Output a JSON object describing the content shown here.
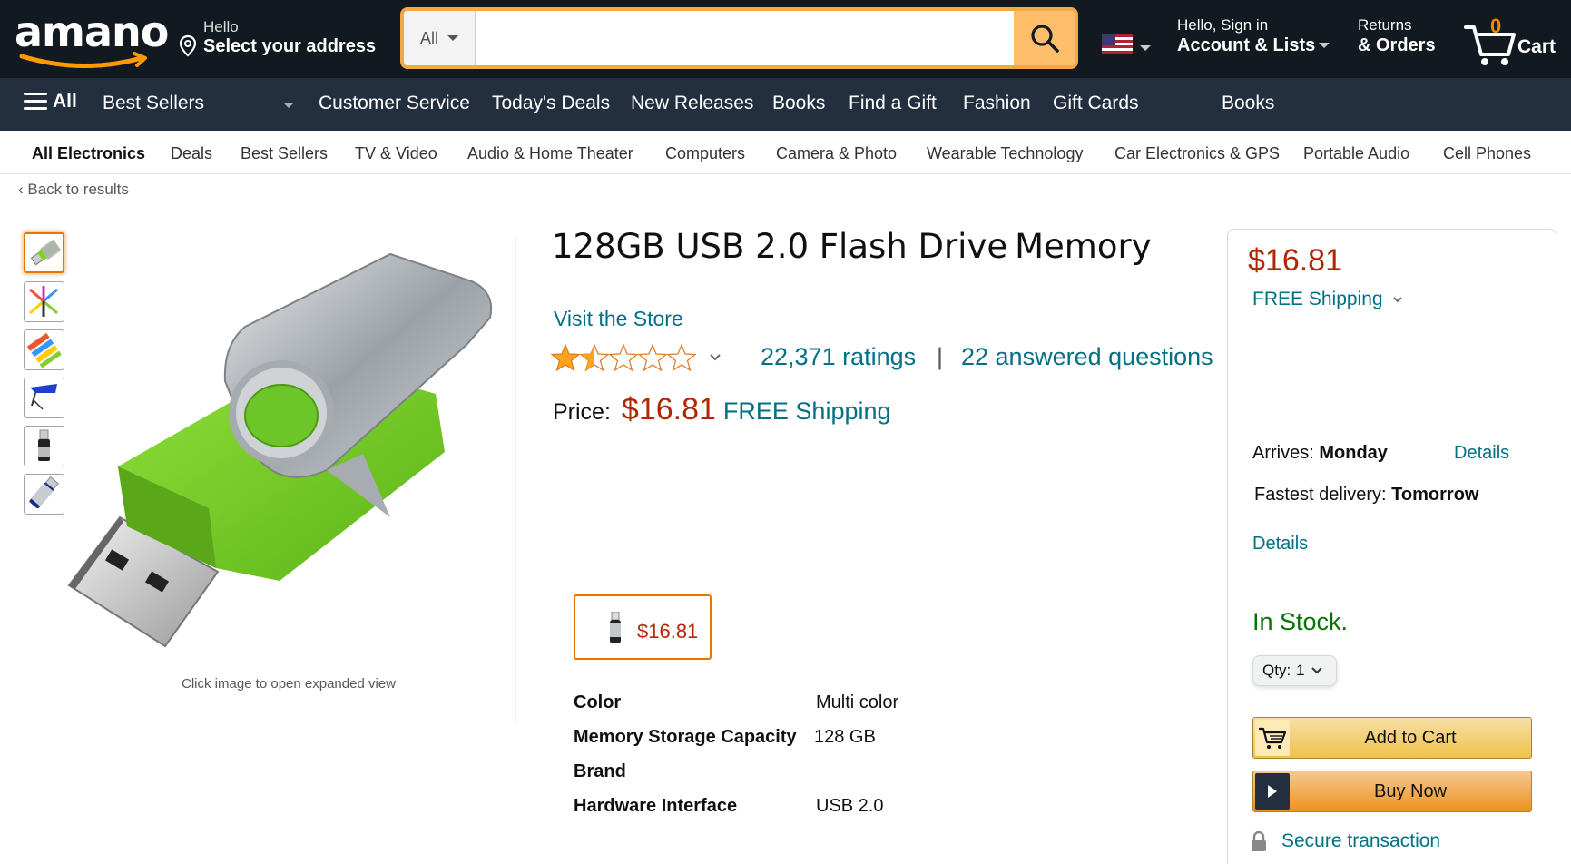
{
  "header": {
    "logo_text": "amano",
    "address_hello": "Hello",
    "address_prompt": "Select your address",
    "search_category": "All",
    "search_value": "",
    "search_placeholder": "",
    "account_hello": "Hello, Sign in",
    "account_lists": "Account & Lists",
    "returns_label": "Returns",
    "orders_label": "& Orders",
    "cart_count": "0",
    "cart_label": "Cart"
  },
  "nav": {
    "all_label": "All",
    "items": [
      "Best Sellers",
      "Customer Service",
      "Today's Deals",
      "New Releases",
      "Books",
      "Find a Gift",
      "Fashion",
      "Gift Cards",
      "Books"
    ]
  },
  "subnav": {
    "items": [
      "All Electronics",
      "Deals",
      "Best Sellers",
      "TV & Video",
      "Audio & Home Theater",
      "Computers",
      "Camera & Photo",
      "Wearable Technology",
      "Car Electronics & GPS",
      "Portable Audio",
      "Cell Phones"
    ]
  },
  "back_to_results": "Back to results",
  "gallery": {
    "caption": "Click image to open expanded view",
    "thumbnail_count": 6,
    "selected_index": 0
  },
  "product": {
    "title": "128GB USB 2.0 Flash Drive",
    "title_suffix": "Memory",
    "store_link": "Visit the Store",
    "rating_stars": 1.5,
    "ratings_count": "22,371 ratings",
    "separator": "|",
    "answered_questions": "22 answered questions",
    "price_label": "Price:",
    "price": "$16.81",
    "shipping": "FREE Shipping",
    "swatch_price": "$16.81",
    "specs": [
      {
        "key": "Color",
        "value": "Multi color"
      },
      {
        "key": "Memory Storage Capacity",
        "value": "128 GB"
      },
      {
        "key": "Brand",
        "value": ""
      },
      {
        "key": "Hardware Interface",
        "value": "USB 2.0"
      }
    ]
  },
  "buybox": {
    "price": "$16.81",
    "shipping": "FREE Shipping",
    "arrives_label": "Arrives:",
    "arrives_day": "Monday",
    "details_link": "Details",
    "fastest_label": "Fastest delivery:",
    "fastest_day": "Tomorrow",
    "details_link_2": "Details",
    "stock": "In Stock.",
    "qty_label": "Qty:",
    "qty_value": "1",
    "add_to_cart": "Add to Cart",
    "buy_now": "Buy Now",
    "secure": "Secure transaction"
  },
  "colors": {
    "topbar": "#131921",
    "navbar": "#232f3e",
    "search_accent": "#febd69",
    "price": "#b12704",
    "link": "#007185",
    "stock": "#007600",
    "star": "#ffa41c",
    "product_green": "#7ed321"
  },
  "icons": [
    "location-pin-icon",
    "search-icon",
    "us-flag-icon",
    "cart-icon",
    "hamburger-icon",
    "star-icon",
    "chevron-down-icon",
    "lock-icon",
    "play-icon"
  ]
}
